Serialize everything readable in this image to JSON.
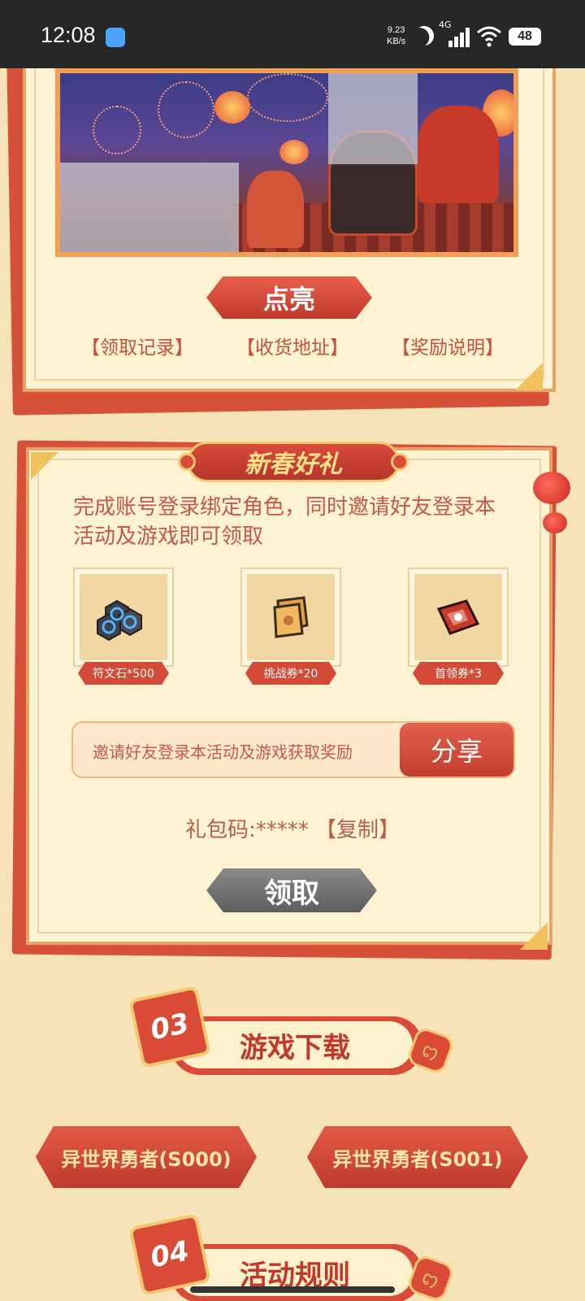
{
  "status_bar": {
    "time": "12:08",
    "speed_value": "9.23",
    "speed_unit": "KB/s",
    "network": "4G",
    "battery": "48"
  },
  "top_panel": {
    "light_button": "点亮",
    "links": [
      "【领取记录】",
      "【收货地址】",
      "【奖励说明】"
    ]
  },
  "gift_panel": {
    "title": "新春好礼",
    "description": "完成账号登录绑定角色，同时邀请好友登录本活动及游戏即可领取",
    "rewards": [
      {
        "label": "符文石*500",
        "icon": "rune-stone-icon"
      },
      {
        "label": "挑战券*20",
        "icon": "challenge-ticket-icon"
      },
      {
        "label": "首领券*3",
        "icon": "boss-ticket-icon"
      }
    ],
    "share_text": "邀请好友登录本活动及游戏获取奖励",
    "share_button": "分享",
    "gift_code": "礼包码:*****  【复制】",
    "claim_button": "领取"
  },
  "download_section": {
    "number": "03",
    "title": "游戏下载",
    "buttons": [
      "异世界勇者(S000)",
      "异世界勇者(S001)"
    ]
  },
  "rules_section": {
    "number": "04",
    "title": "活动规则"
  },
  "colors": {
    "background": "#f7e3b8",
    "accent_red": "#d94a37",
    "gold": "#f3c870",
    "panel": "#fdf3d2"
  }
}
